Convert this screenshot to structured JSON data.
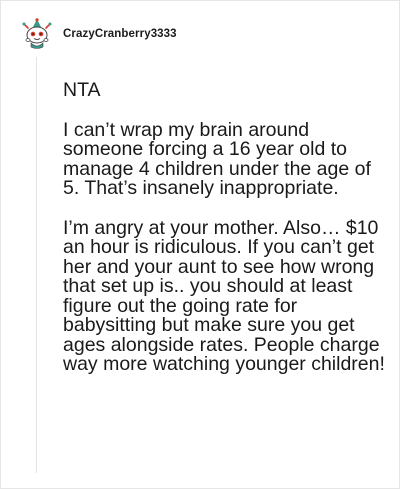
{
  "comment": {
    "author": {
      "username": "CrazyCranberry3333",
      "avatar_icon": "snoo-avatar-icon"
    },
    "paragraphs": [
      "NTA",
      "I can’t wrap my brain around someone forcing a 16 year old to manage 4 children under the age of 5. That’s insanely inappropriate.",
      "I’m angry at your mother. Also… $10 an hour is ridiculous. If you can’t get her and your aunt to see how wrong that set up is.. you should at least figure out the going rate for babysitting but make sure you get ages alongside rates. People charge way more watching younger children!"
    ]
  },
  "colors": {
    "text": "#1a1a1a",
    "thread_line": "#e3e3e3",
    "border": "#e6e6e6",
    "avatar_accent_red": "#d93a2b",
    "avatar_accent_teal": "#3a9a8a"
  }
}
